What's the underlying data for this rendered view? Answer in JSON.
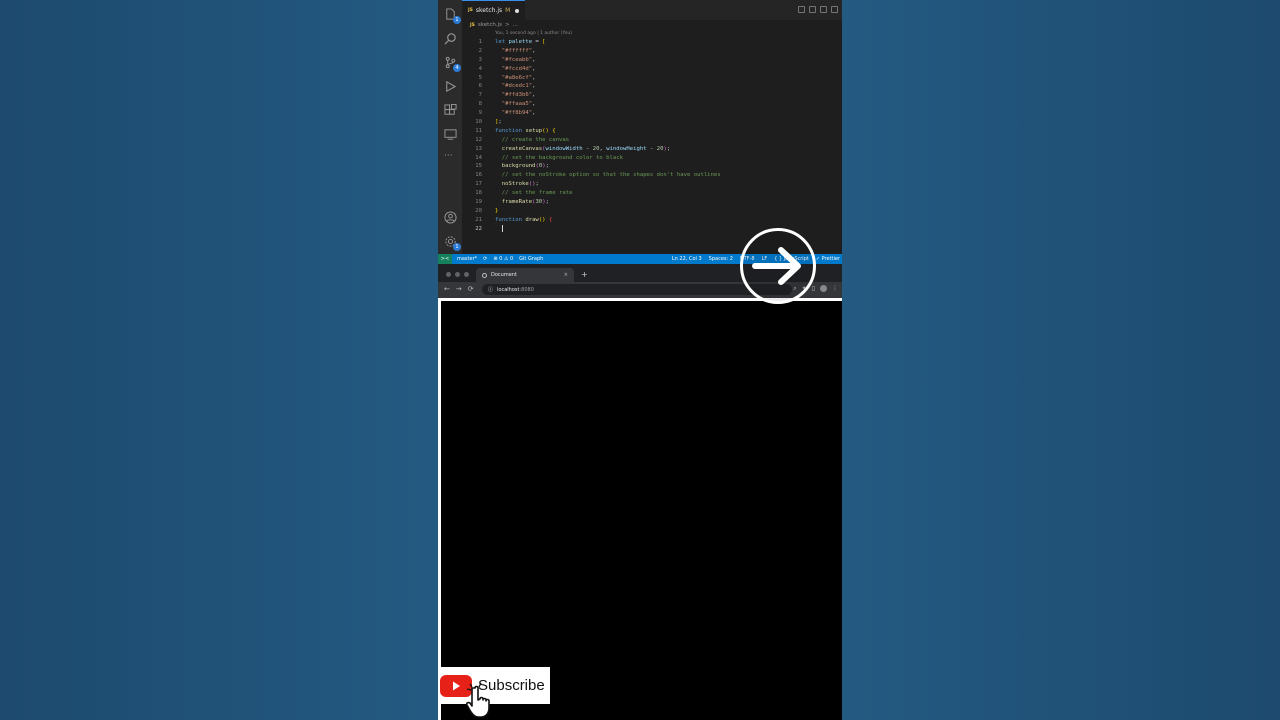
{
  "editor": {
    "tab": {
      "badge": "JS",
      "filename": "sketch.js",
      "modified": "M"
    },
    "breadcrumb": {
      "badge": "JS",
      "file": "sketch.js",
      "sep": ">",
      "more": "..."
    },
    "codelens": "You, 1 second ago | 1 author (You)",
    "activity_badges": {
      "explorer": "1",
      "scm": "4",
      "accounts": "1"
    },
    "code_lines": [
      {
        "n": "1",
        "html": "<span class=\"kw\">let</span> <span class=\"var\">palette</span> = <span class=\"br\">[</span>"
      },
      {
        "n": "2",
        "html": "  <span class=\"str\">\"#ffffff\"</span>,"
      },
      {
        "n": "3",
        "html": "  <span class=\"str\">\"#fceabb\"</span>,"
      },
      {
        "n": "4",
        "html": "  <span class=\"str\">\"#fccd4d\"</span>,"
      },
      {
        "n": "5",
        "html": "  <span class=\"str\">\"#a8e6cf\"</span>,"
      },
      {
        "n": "6",
        "html": "  <span class=\"str\">\"#dcedc1\"</span>,"
      },
      {
        "n": "7",
        "html": "  <span class=\"str\">\"#ffd3b6\"</span>,"
      },
      {
        "n": "8",
        "html": "  <span class=\"str\">\"#ffaaa5\"</span>,"
      },
      {
        "n": "9",
        "html": "  <span class=\"str\">\"#ff8b94\"</span>,"
      },
      {
        "n": "10",
        "html": "<span class=\"br\">]</span>;"
      },
      {
        "n": "11",
        "html": "<span class=\"kw\">function</span> <span class=\"fn\">setup</span><span class=\"br\">()</span> <span class=\"br\">{</span>"
      },
      {
        "n": "12",
        "html": "  <span class=\"cm\">// create the canvas</span>"
      },
      {
        "n": "13",
        "html": "  <span class=\"fn\">createCanvas</span><span class=\"br2\">(</span><span class=\"var\">windowWidth</span> - <span class=\"num\">20</span>, <span class=\"var\">windowHeight</span> - <span class=\"num\">20</span><span class=\"br2\">)</span>;"
      },
      {
        "n": "14",
        "html": "  <span class=\"cm\">// set the background color to black</span>"
      },
      {
        "n": "15",
        "html": "  <span class=\"fn\">background</span><span class=\"br2\">(</span><span class=\"num\">0</span><span class=\"br2\">)</span>;"
      },
      {
        "n": "16",
        "html": "  <span class=\"cm\">// set the noStroke option so that the shapes don't have outlines</span>"
      },
      {
        "n": "17",
        "html": "  <span class=\"fn\">noStroke</span><span class=\"br2\">()</span>;"
      },
      {
        "n": "18",
        "html": "  <span class=\"cm\">// set the frame rate</span>"
      },
      {
        "n": "19",
        "html": "  <span class=\"fn\">frameRate</span><span class=\"br2\">(</span><span class=\"num\">30</span><span class=\"br2\">)</span>;"
      },
      {
        "n": "20",
        "html": "<span class=\"br\">}</span>"
      },
      {
        "n": "21",
        "html": "<span class=\"kw\">function</span> <span class=\"fn\">draw</span><span class=\"br\">()</span> <span style=\"color:#f14c4c\">{</span>"
      },
      {
        "n": "22",
        "html": "  <span class=\"cursor\"></span>",
        "current": true
      }
    ]
  },
  "statusbar": {
    "remote": "><",
    "branch": "master*",
    "sync": "⟳",
    "problems": "⊗ 0 ⚠ 0",
    "git_graph": "Git Graph",
    "position": "Ln 22, Col 3",
    "spaces": "Spaces: 2",
    "encoding": "UTF-8",
    "eol": "LF",
    "language": "{ } JavaScript",
    "prettier": "✓ Prettier"
  },
  "browser": {
    "tab_title": "Document",
    "tab_close": "×",
    "new_tab": "+",
    "url_host": "localhost",
    "url_port": ":8080"
  },
  "overlay": {
    "subscribe_label": "Subscribe"
  },
  "colors": {
    "accent": "#007acc",
    "youtube_red": "#e62117",
    "canvas_bg": "#000000"
  }
}
